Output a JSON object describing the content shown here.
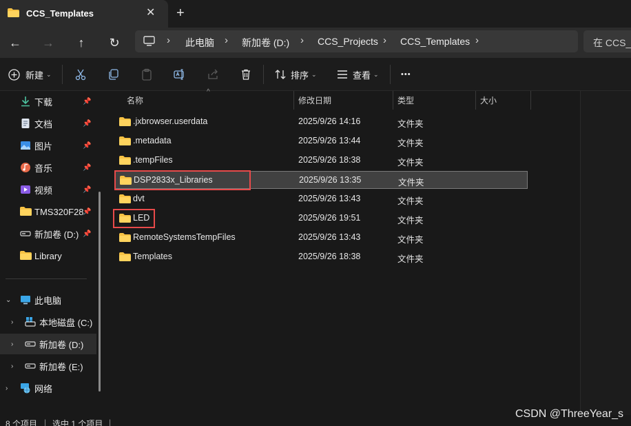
{
  "tab": {
    "title": "CCS_Templates",
    "close": "✕",
    "new_tab": "+"
  },
  "nav": {
    "back": "←",
    "forward": "→",
    "up": "↑",
    "refresh": "↻"
  },
  "breadcrumb": [
    "此电脑",
    "新加卷 (D:)",
    "CCS_Projects",
    "CCS_Templates"
  ],
  "search": {
    "text": "在 CCS_T"
  },
  "toolbar": {
    "new_label": "新建",
    "sort_label": "排序",
    "view_label": "查看",
    "more_label": "•••"
  },
  "sidebar": {
    "quick": [
      {
        "label": "下载",
        "icon": "download-icon"
      },
      {
        "label": "文档",
        "icon": "document-icon"
      },
      {
        "label": "图片",
        "icon": "picture-icon"
      },
      {
        "label": "音乐",
        "icon": "music-icon"
      },
      {
        "label": "视频",
        "icon": "video-icon"
      },
      {
        "label": "TMS320F28",
        "icon": "folder-icon"
      },
      {
        "label": "新加卷 (D:)",
        "icon": "drive-icon"
      },
      {
        "label": "Library",
        "icon": "folder-icon"
      }
    ],
    "tree": [
      {
        "label": "此电脑",
        "icon": "computer-icon"
      },
      {
        "label": "本地磁盘 (C:)",
        "icon": "system-drive-icon"
      },
      {
        "label": "新加卷 (D:)",
        "icon": "drive-icon"
      },
      {
        "label": "新加卷 (E:)",
        "icon": "drive-icon"
      },
      {
        "label": "网络",
        "icon": "network-icon"
      }
    ]
  },
  "columns": {
    "name": "名称",
    "date": "修改日期",
    "type": "类型",
    "size": "大小"
  },
  "files": [
    {
      "name": ".jxbrowser.userdata",
      "date": "2025/9/26 14:16",
      "type": "文件夹"
    },
    {
      "name": ".metadata",
      "date": "2025/9/26 13:44",
      "type": "文件夹"
    },
    {
      "name": ".tempFiles",
      "date": "2025/9/26 18:38",
      "type": "文件夹"
    },
    {
      "name": "DSP2833x_Libraries",
      "date": "2025/9/26 13:35",
      "type": "文件夹"
    },
    {
      "name": "dvt",
      "date": "2025/9/26 13:43",
      "type": "文件夹"
    },
    {
      "name": "LED",
      "date": "2025/9/26 19:51",
      "type": "文件夹"
    },
    {
      "name": "RemoteSystemsTempFiles",
      "date": "2025/9/26 13:43",
      "type": "文件夹"
    },
    {
      "name": "Templates",
      "date": "2025/9/26 18:38",
      "type": "文件夹"
    }
  ],
  "status": {
    "count": "8 个项目",
    "selected": "选中 1 个项目"
  },
  "watermark": "CSDN @ThreeYear_s",
  "colors": {
    "folder": "#f7c244",
    "highlight": "#e84a4a",
    "selection": "#414141"
  }
}
